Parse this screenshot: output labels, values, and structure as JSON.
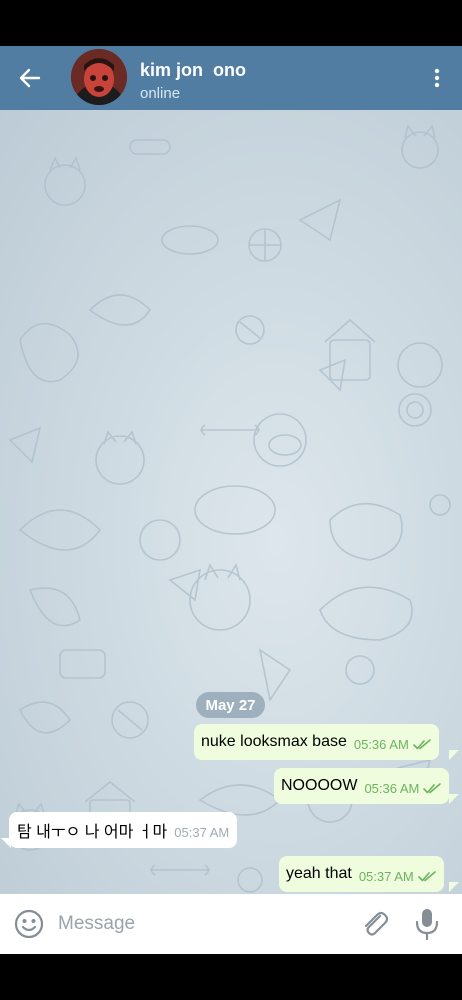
{
  "header": {
    "contact_name": "kim jon  ono",
    "contact_status": "online",
    "avatar_name": "avatar"
  },
  "colors": {
    "header": "#517da2",
    "outgoing_bubble": "#effdde",
    "incoming_bubble": "#ffffff",
    "check_color": "#6cb35f"
  },
  "chat": {
    "date_separator": "May 27",
    "messages": [
      {
        "direction": "outgoing",
        "text": "nuke looksmax base",
        "time": "05:36 AM",
        "status": "read"
      },
      {
        "direction": "outgoing",
        "text": "NOOOOW",
        "time": "05:36 AM",
        "status": "read"
      },
      {
        "direction": "incoming",
        "text": "탐 내ㅜㅇ 나 어마 ㅓ마",
        "time": "05:37 AM"
      },
      {
        "direction": "outgoing",
        "text": "yeah that",
        "time": "05:37 AM",
        "status": "read"
      }
    ]
  },
  "composer": {
    "placeholder": "Message"
  },
  "icons": {
    "back": "arrow-left-icon",
    "menu": "more-vertical-icon",
    "emoji": "smiley-icon",
    "attach": "paperclip-icon",
    "mic": "microphone-icon"
  }
}
